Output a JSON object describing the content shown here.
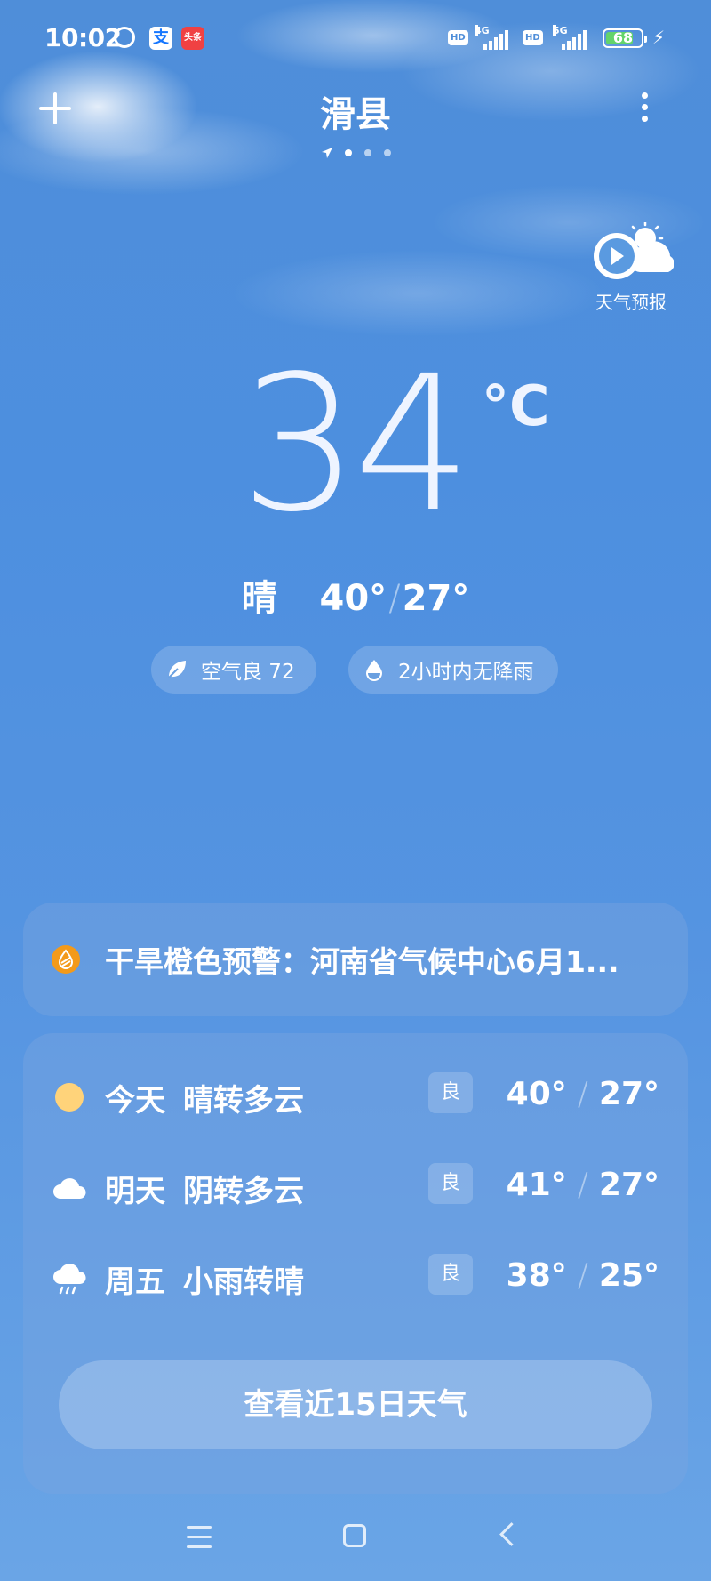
{
  "status_bar": {
    "time": "10:02",
    "alipay_glyph": "支",
    "toutiao_glyph": "头条",
    "hd1": "HD",
    "net1": "4G",
    "hd2": "HD",
    "net2": "5G",
    "battery": "68",
    "charging_glyph": "⚡"
  },
  "header": {
    "city": "滑县",
    "page_count": 3,
    "active_page": 1
  },
  "forecast_video": {
    "label": "天气预报"
  },
  "current": {
    "temperature": "34",
    "unit": "°C",
    "condition": "晴",
    "high": "40°",
    "separator": "/",
    "low": "27°"
  },
  "pills": {
    "air": {
      "label": "空气良 72",
      "icon": "leaf-icon"
    },
    "rain": {
      "label": "2小时内无降雨",
      "icon": "water-drop-icon"
    }
  },
  "alert": {
    "text": "干旱橙色预警：河南省气候中心6月1...",
    "icon": "drought-warning-icon",
    "color": "#f39a1a"
  },
  "forecast": [
    {
      "day": "今天",
      "condition": "晴转多云",
      "aqi": "良",
      "high": "40°",
      "low": "27°",
      "icon": "sun-icon"
    },
    {
      "day": "明天",
      "condition": "阴转多云",
      "aqi": "良",
      "high": "41°",
      "low": "27°",
      "icon": "cloud-icon"
    },
    {
      "day": "周五",
      "condition": "小雨转晴",
      "aqi": "良",
      "high": "38°",
      "low": "25°",
      "icon": "rain-cloud-icon"
    }
  ],
  "forecast_slash": "/",
  "fifteen_day_button": "查看近15日天气",
  "colors": {
    "sky": "#4f8ed9",
    "sun": "#ffd37a",
    "warning": "#f39a1a"
  }
}
